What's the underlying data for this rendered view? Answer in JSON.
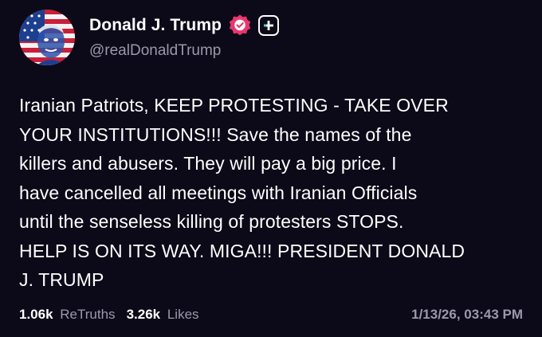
{
  "author": {
    "display_name": "Donald J. Trump",
    "handle": "@realDonaldTrump",
    "avatar_icon": "american-flag-portrait",
    "verified_icon": "verified-badge-icon",
    "follow_icon": "plus-icon"
  },
  "post": {
    "text": "Iranian Patriots, KEEP PROTESTING - TAKE OVER\nYOUR INSTITUTIONS!!! Save the names of the\nkillers and abusers. They will pay a big price. I\nhave cancelled all meetings with Iranian Officials\nuntil the senseless killing of protesters STOPS.\nHELP IS ON ITS WAY. MIGA!!! PRESIDENT DONALD\nJ. TRUMP"
  },
  "stats": {
    "retruths_count": "1.06k",
    "retruths_label": "ReTruths",
    "likes_count": "3.26k",
    "likes_label": "Likes"
  },
  "timestamp": "1/13/26, 03:43 PM",
  "colors": {
    "background": "#0c0a18",
    "text": "#ffffff",
    "muted": "#9b98ab",
    "badge_pink": "#e8376f",
    "follow_accent": "#3fd6c4"
  }
}
